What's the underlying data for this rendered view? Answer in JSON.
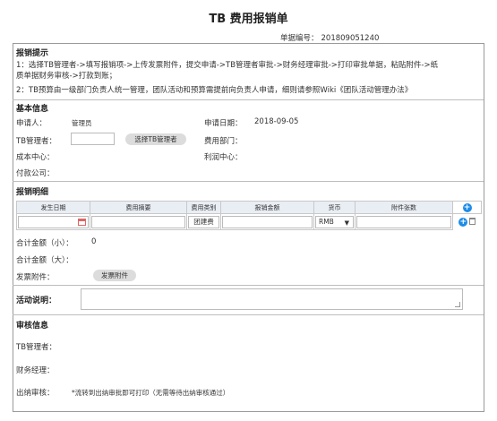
{
  "header": {
    "title": "TB 费用报销单",
    "doc_no_label": "单据编号：",
    "doc_no_value": "201809051240"
  },
  "tips": {
    "title": "报销提示",
    "line1": "1：选择TB管理者->填写报销项->上传发票附件，提交申请->TB管理者审批->财务经理审批->打印审批单据，粘贴附件->纸",
    "line2": "质单据财务审核->打款到账；",
    "line3": "2：TB预算由一级部门负责人统一管理，团队活动和预算需提前向负责人申请，细则请参照Wiki《团队活动管理办法》"
  },
  "basic": {
    "title": "基本信息",
    "applicant_label": "申请人：",
    "applicant_value": "管理员",
    "date_label": "申请日期：",
    "date_value": "2018-09-05",
    "tb_manager_label": "TB管理者：",
    "select_manager_button": "选择TB管理者",
    "dept_label": "费用部门：",
    "cost_center_label": "成本中心：",
    "profit_center_label": "利润中心：",
    "payer_label": "付款公司："
  },
  "detail": {
    "title": "报销明细",
    "columns": [
      "发生日期",
      "费用摘要",
      "费用类别",
      "报销金额",
      "货币",
      "附件张数"
    ],
    "row": {
      "category": "团建费",
      "currency": "RMB"
    },
    "total_small_label": "合计金额（小）：",
    "total_small_value": "0",
    "total_big_label": "合计金额（大）：",
    "invoice_label": "发票附件：",
    "invoice_button": "发票附件"
  },
  "activity": {
    "label": "活动说明："
  },
  "review": {
    "title": "审核信息",
    "tb_manager_label": "TB管理者：",
    "finance_manager_label": "财务经理：",
    "cashier_label": "出纳审核：",
    "cashier_note": "*流转到出纳审批即可打印（无需等待出纳审核通过）"
  },
  "icons": {
    "add": "plus-circle-icon",
    "delete": "trash-icon",
    "calendar": "calendar-icon",
    "dropdown": "caret-down-icon"
  },
  "colors": {
    "accent": "#1c8ce8",
    "table_header": "#e9eef5"
  }
}
